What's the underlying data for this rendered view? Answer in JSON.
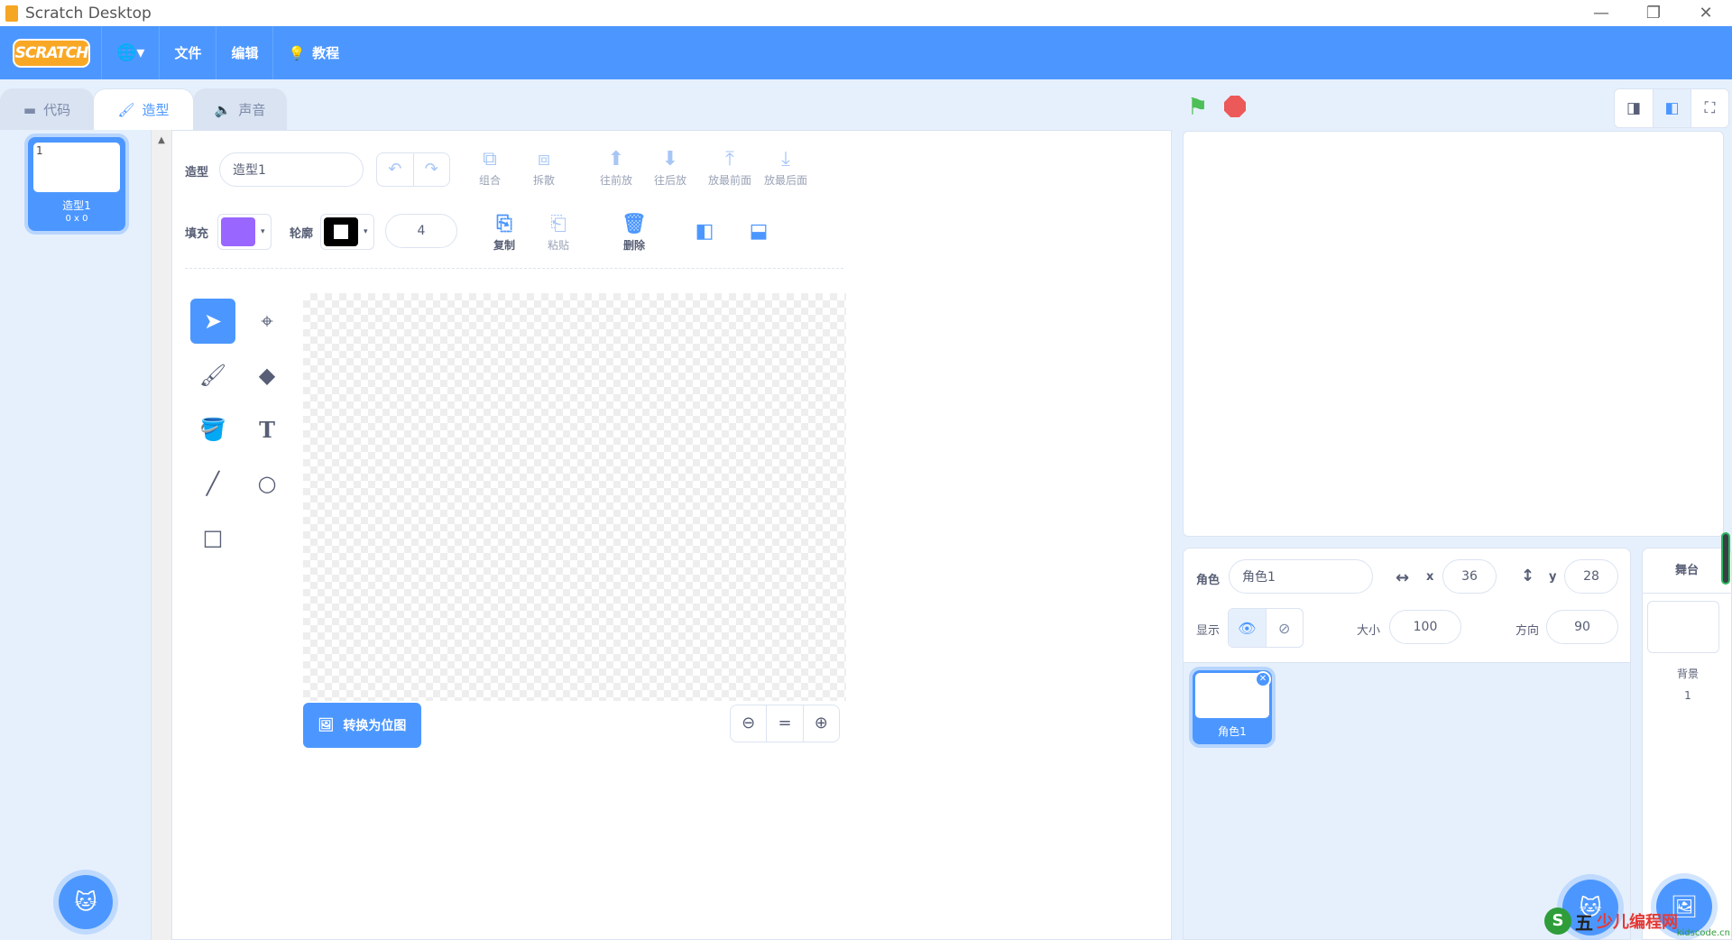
{
  "window": {
    "title": "Scratch Desktop",
    "minimize": "—",
    "restore": "❐",
    "close": "✕"
  },
  "menubar": {
    "logo": "SCRATCH",
    "language_icon": "🌐▾",
    "file": "文件",
    "edit": "编辑",
    "tutorials": "教程"
  },
  "tabs": [
    {
      "label": "代码",
      "icon": "code-icon"
    },
    {
      "label": "造型",
      "icon": "brush-icon"
    },
    {
      "label": "声音",
      "icon": "speaker-icon"
    }
  ],
  "costumes": [
    {
      "number": "1",
      "name": "造型1",
      "size": "0 x 0"
    }
  ],
  "paint": {
    "costume_label": "造型",
    "costume_name": "造型1",
    "group": "组合",
    "ungroup": "拆散",
    "forward": "往前放",
    "backward": "往后放",
    "front": "放最前面",
    "back": "放最后面",
    "fill_label": "填充",
    "outline_label": "轮廓",
    "stroke_width": "4",
    "copy": "复制",
    "paste": "粘贴",
    "delete": "删除",
    "convert_bitmap": "转换为位图",
    "fill_color": "#9966ff",
    "outline_color": "#000000"
  },
  "stage_header": {
    "flag_color": "#4cbf56",
    "stop_color": "#ec5959"
  },
  "sprite_info": {
    "sprite_label": "角色",
    "sprite_name": "角色1",
    "x_label": "x",
    "x": "36",
    "y_label": "y",
    "y": "28",
    "show_label": "显示",
    "size_label": "大小",
    "size": "100",
    "direction_label": "方向",
    "direction": "90"
  },
  "sprites": [
    {
      "name": "角色1"
    }
  ],
  "stage_panel": {
    "title": "舞台",
    "backdrop_label": "背景",
    "backdrop_count": "1"
  },
  "watermark": {
    "s": "S",
    "five": "五",
    "brand": "少儿编程网",
    "url": "kidscode.cn"
  }
}
